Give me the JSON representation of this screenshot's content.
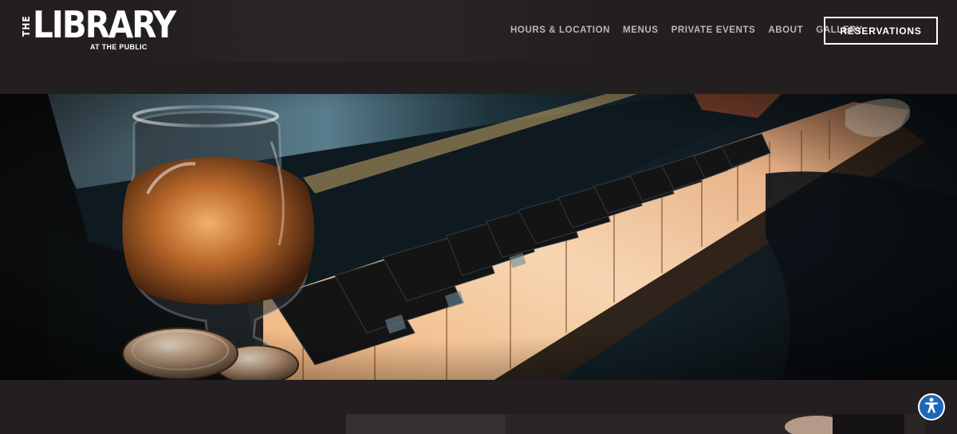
{
  "brand": {
    "the": "THE",
    "name": "LIBRARY",
    "sub": "AT THE PUBLIC"
  },
  "nav": {
    "items": [
      {
        "label": "HOURS & LOCATION"
      },
      {
        "label": "MENUS"
      },
      {
        "label": "PRIVATE EVENTS"
      },
      {
        "label": "ABOUT"
      },
      {
        "label": "GALLERY"
      }
    ],
    "cta": "RESERVATIONS"
  },
  "hero": {
    "image": "piano-keys-with-brandy-glass-and-coins"
  },
  "accessibility": {
    "icon": "accessibility-person-icon"
  },
  "colors": {
    "background": "#231f20",
    "nav_text": "#bdb7b3",
    "accessibility_blue": "#1f66b8"
  }
}
